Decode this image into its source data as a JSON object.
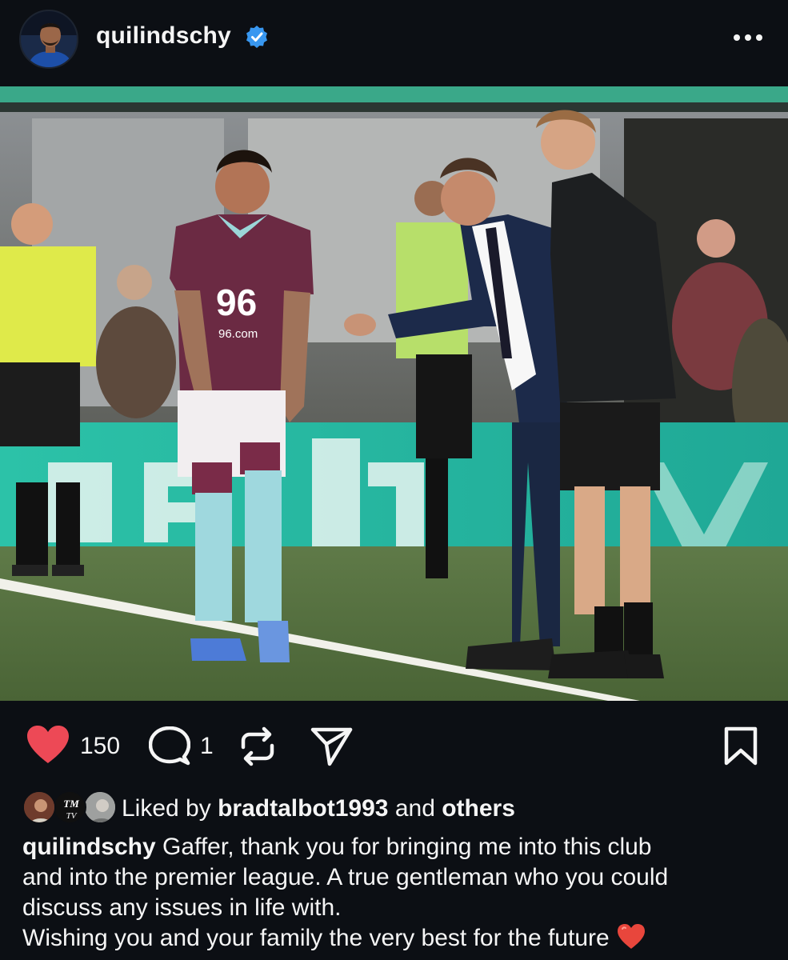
{
  "post": {
    "username": "quilindschy",
    "verified": true,
    "avatar_icon": "profile-avatar",
    "more_icon": "more-horizontal-icon"
  },
  "actions": {
    "like_count": "150",
    "comment_count": "1",
    "liked": true,
    "like_color": "#ed4956",
    "icons": [
      "heart-icon",
      "comment-icon",
      "repost-icon",
      "share-icon",
      "bookmark-icon"
    ]
  },
  "likes": {
    "prefix": "Liked by ",
    "user": "bradtalbot1993",
    "conjunction": " and ",
    "others": "others",
    "avatar_text": "TM\nTV"
  },
  "caption": {
    "user": "quilindschy",
    "line1": " Gaffer, thank you for bringing me into this club",
    "line2": "and into the premier league. A true gentleman who you could",
    "line3": "discuss any issues in life with.",
    "line4": "Wishing you and your family the very best for the future",
    "emoji": "❤️"
  },
  "photo": {
    "sponsor_text": "96",
    "sponsor_url": "96.com",
    "description_icon": "football-sideline-photo"
  },
  "colors": {
    "background": "#0c0f14",
    "text": "#f5f5f5",
    "verified_blue": "#3897f0"
  }
}
